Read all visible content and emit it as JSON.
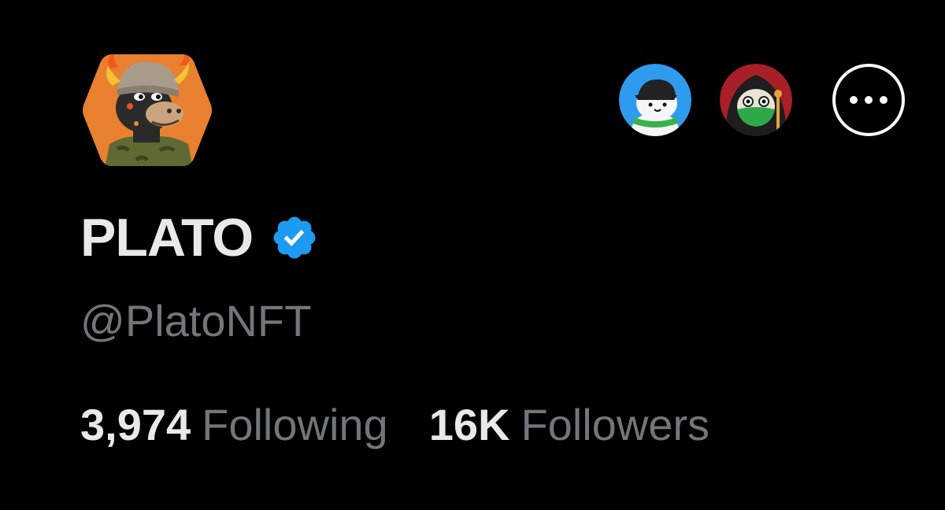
{
  "profile": {
    "display_name": "PLATO",
    "handle": "@PlatoNFT",
    "verified": true,
    "avatar_icon": "bull-nft-avatar-icon",
    "avatar_bg_color": "#e8802f"
  },
  "stats": {
    "following_count": "3,974",
    "following_label": "Following",
    "followers_count": "16K",
    "followers_label": "Followers"
  },
  "mutual_followers": [
    {
      "icon": "white-cat-avatar-icon",
      "bg_color": "#2f9bef"
    },
    {
      "icon": "hooded-frog-avatar-icon",
      "bg_color": "#a81f2a"
    }
  ],
  "actions": {
    "more_icon": "more-options-icon"
  },
  "colors": {
    "background": "#000000",
    "primary_text": "#e7e9ea",
    "secondary_text": "#71767b",
    "verified_blue": "#1d9bf0"
  }
}
